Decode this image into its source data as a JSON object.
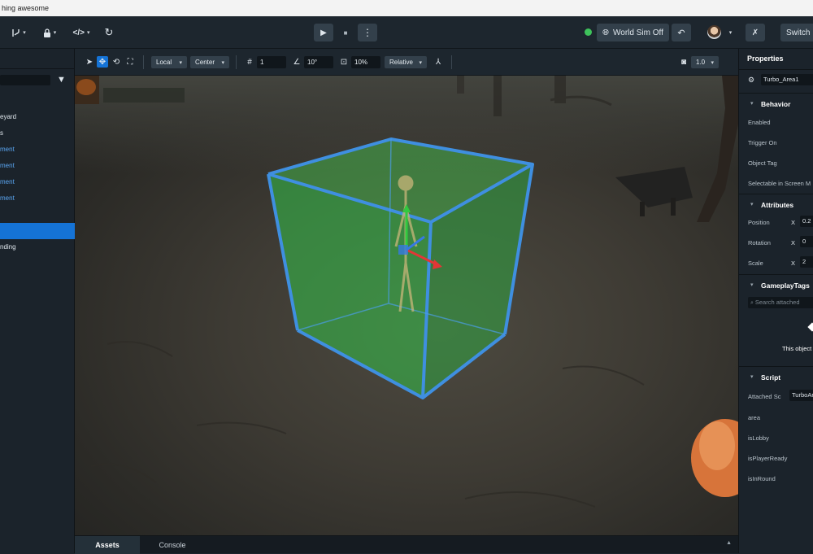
{
  "window": {
    "title": "hing awesome"
  },
  "topbar": {
    "world_sim_label": "World Sim Off",
    "switch_label": "Switch",
    "caret": "▾"
  },
  "left_panel": {
    "items": [
      {
        "label": "eyard",
        "style": "normal"
      },
      {
        "label": "s",
        "style": "normal"
      },
      {
        "label": "ment",
        "style": "blue"
      },
      {
        "label": "ment",
        "style": "blue"
      },
      {
        "label": "ment",
        "style": "blue"
      },
      {
        "label": "ment",
        "style": "blue"
      },
      {
        "label": "",
        "style": "normal"
      },
      {
        "label": "",
        "style": "selected"
      },
      {
        "label": "nding",
        "style": "normal"
      }
    ]
  },
  "viewport_toolbar": {
    "space_mode": "Local",
    "pivot_mode": "Center",
    "grid_snap": "1",
    "angle_snap": "10°",
    "scale_snap": "10%",
    "snap_mode": "Relative",
    "camera_speed": "1.0"
  },
  "bottom_tabs": {
    "assets": "Assets",
    "console": "Console"
  },
  "properties": {
    "title": "Properties",
    "object_name": "Turbo_Area1",
    "behavior": {
      "label": "Behavior",
      "enabled": "Enabled",
      "trigger_on": "Trigger On",
      "object_tag": "Object Tag",
      "selectable": "Selectable in Screen M"
    },
    "attributes": {
      "label": "Attributes",
      "position": "Position",
      "rotation": "Rotation",
      "scale": "Scale",
      "axis": "X",
      "position_x": "0.2",
      "rotation_x": "0",
      "scale_x": "2"
    },
    "gameplay_tags": {
      "label": "GameplayTags",
      "search_placeholder": "Search attached",
      "empty_text": "This object"
    },
    "script": {
      "label": "Script",
      "attached_script": "Attached Sc",
      "script_name": "TurboAr",
      "var_area": "area",
      "var_is_lobby": "isLobby",
      "var_is_player_ready": "isPlayerReady",
      "var_is_in_round": "isInRound"
    }
  },
  "colors": {
    "accent": "#1573d6",
    "link": "#5aa6f2",
    "status_green": "#3ec25b",
    "trigger_fill": "#35c24a",
    "trigger_edge": "#3f8fe0"
  }
}
